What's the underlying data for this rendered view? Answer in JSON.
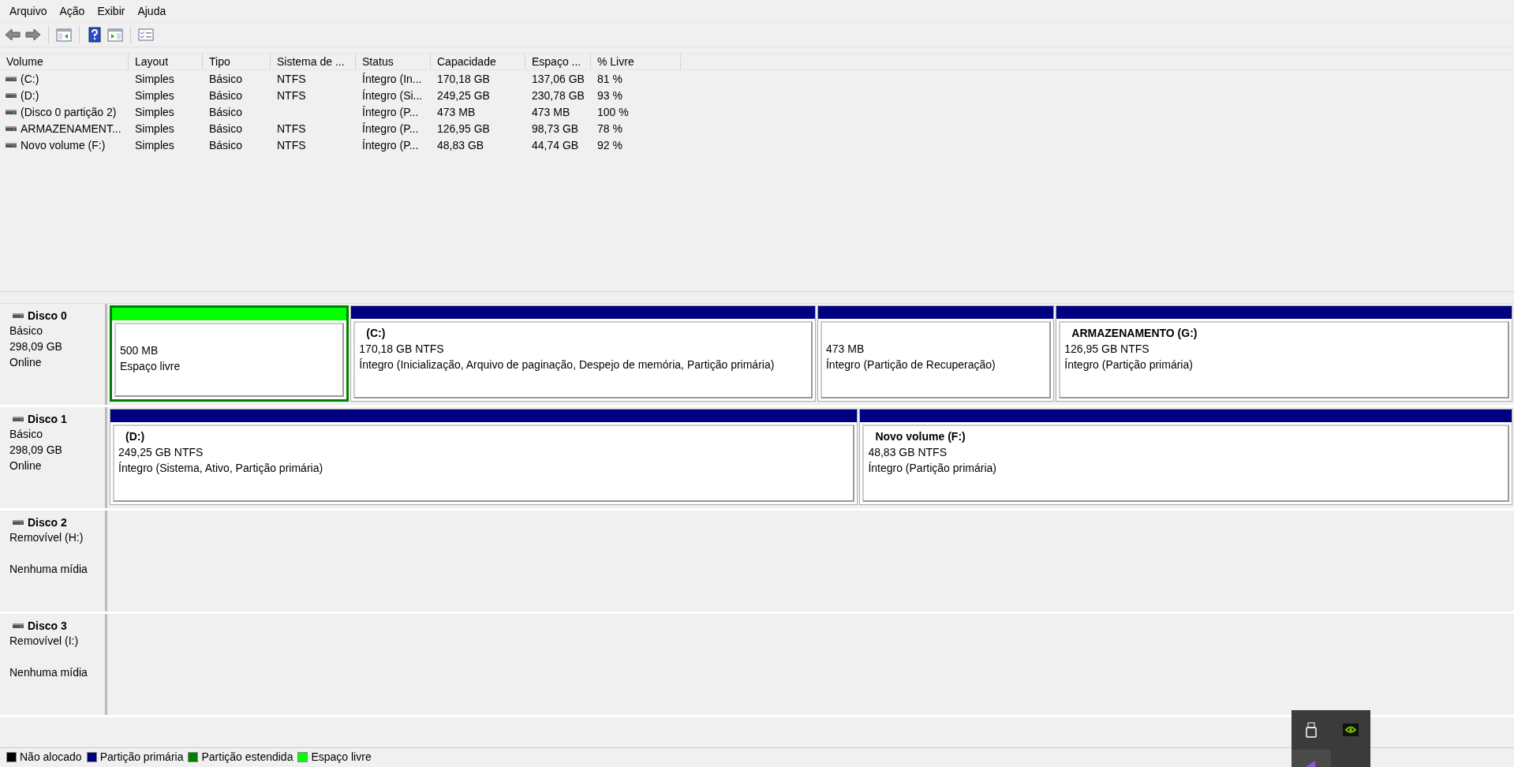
{
  "menu": [
    "Arquivo",
    "Ação",
    "Exibir",
    "Ajuda"
  ],
  "table": {
    "columns": [
      "Volume",
      "Layout",
      "Tipo",
      "Sistema de ...",
      "Status",
      "Capacidade",
      "Espaço ...",
      "% Livre"
    ],
    "rows": [
      [
        "(C:)",
        "Simples",
        "Básico",
        "NTFS",
        "Íntegro (In...",
        "170,18 GB",
        "137,06 GB",
        "81 %"
      ],
      [
        "(D:)",
        "Simples",
        "Básico",
        "NTFS",
        "Íntegro (Si...",
        "249,25 GB",
        "230,78 GB",
        "93 %"
      ],
      [
        "(Disco 0 partição 2)",
        "Simples",
        "Básico",
        "",
        "Íntegro (P...",
        "473 MB",
        "473 MB",
        "100 %"
      ],
      [
        "ARMAZENAMENT...",
        "Simples",
        "Básico",
        "NTFS",
        "Íntegro (P...",
        "126,95 GB",
        "98,73 GB",
        "78 %"
      ],
      [
        "Novo volume (F:)",
        "Simples",
        "Básico",
        "NTFS",
        "Íntegro (P...",
        "48,83 GB",
        "44,74 GB",
        "92 %"
      ]
    ]
  },
  "disks": [
    {
      "name": "Disco 0",
      "type": "Básico",
      "size": "298,09 GB",
      "status": "Online",
      "partitions": [
        {
          "size": "500 MB",
          "status": "Espaço livre",
          "color": "#00ff00",
          "selected": true
        },
        {
          "title": "(C:)",
          "size": "170,18 GB NTFS",
          "status": "Íntegro (Inicialização, Arquivo de paginação, Despejo de memória, Partição primária)",
          "color": "#000080",
          "selected": false
        },
        {
          "size": "473 MB",
          "status": "Íntegro (Partição de Recuperação)",
          "color": "#000080",
          "selected": false
        },
        {
          "title": "ARMAZENAMENTO  (G:)",
          "size": "126,95 GB NTFS",
          "status": "Íntegro (Partição primária)",
          "color": "#000080",
          "selected": false
        }
      ]
    },
    {
      "name": "Disco 1",
      "type": "Básico",
      "size": "298,09 GB",
      "status": "Online",
      "partitions": [
        {
          "title": "(D:)",
          "size": "249,25 GB NTFS",
          "status": "Íntegro (Sistema, Ativo, Partição primária)",
          "color": "#000080",
          "selected": false
        },
        {
          "title": "Novo volume  (F:)",
          "size": "48,83 GB NTFS",
          "status": "Íntegro (Partição primária)",
          "color": "#000080",
          "selected": false
        }
      ]
    },
    {
      "name": "Disco 2",
      "type": "Removível (H:)",
      "status": "Nenhuma mídia"
    },
    {
      "name": "Disco 3",
      "type": "Removível (I:)",
      "status": "Nenhuma mídia"
    }
  ],
  "legend": [
    {
      "label": "Não alocado",
      "color": "#000000"
    },
    {
      "label": "Partição primária",
      "color": "#000080"
    },
    {
      "label": "Partição estendida",
      "color": "#008000"
    },
    {
      "label": "Espaço livre",
      "color": "#00ff00"
    }
  ]
}
